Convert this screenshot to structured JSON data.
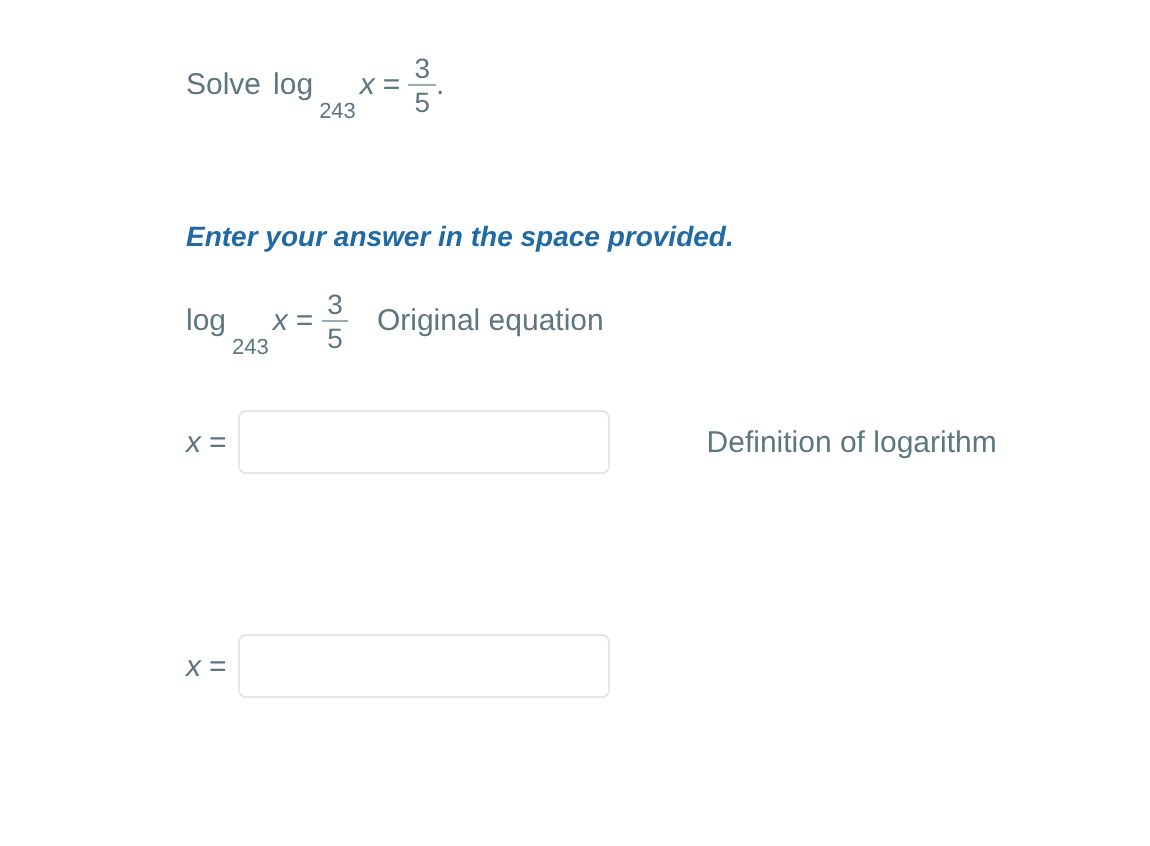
{
  "problem": {
    "verb": "Solve",
    "equation": {
      "func": "log",
      "base": "243",
      "variable": "x",
      "equals": "=",
      "numerator": "3",
      "denominator": "5"
    },
    "period": "."
  },
  "instruction": "Enter your answer in the space provided.",
  "steps": [
    {
      "kind": "equation",
      "equation": {
        "func": "log",
        "base": "243",
        "variable": "x",
        "equals": "=",
        "numerator": "3",
        "denominator": "5"
      },
      "reason": "Original equation"
    },
    {
      "kind": "answer",
      "variable": "x",
      "equals": "=",
      "reason": "Definition of logarithm"
    },
    {
      "kind": "answer",
      "variable": "x",
      "equals": "="
    }
  ]
}
